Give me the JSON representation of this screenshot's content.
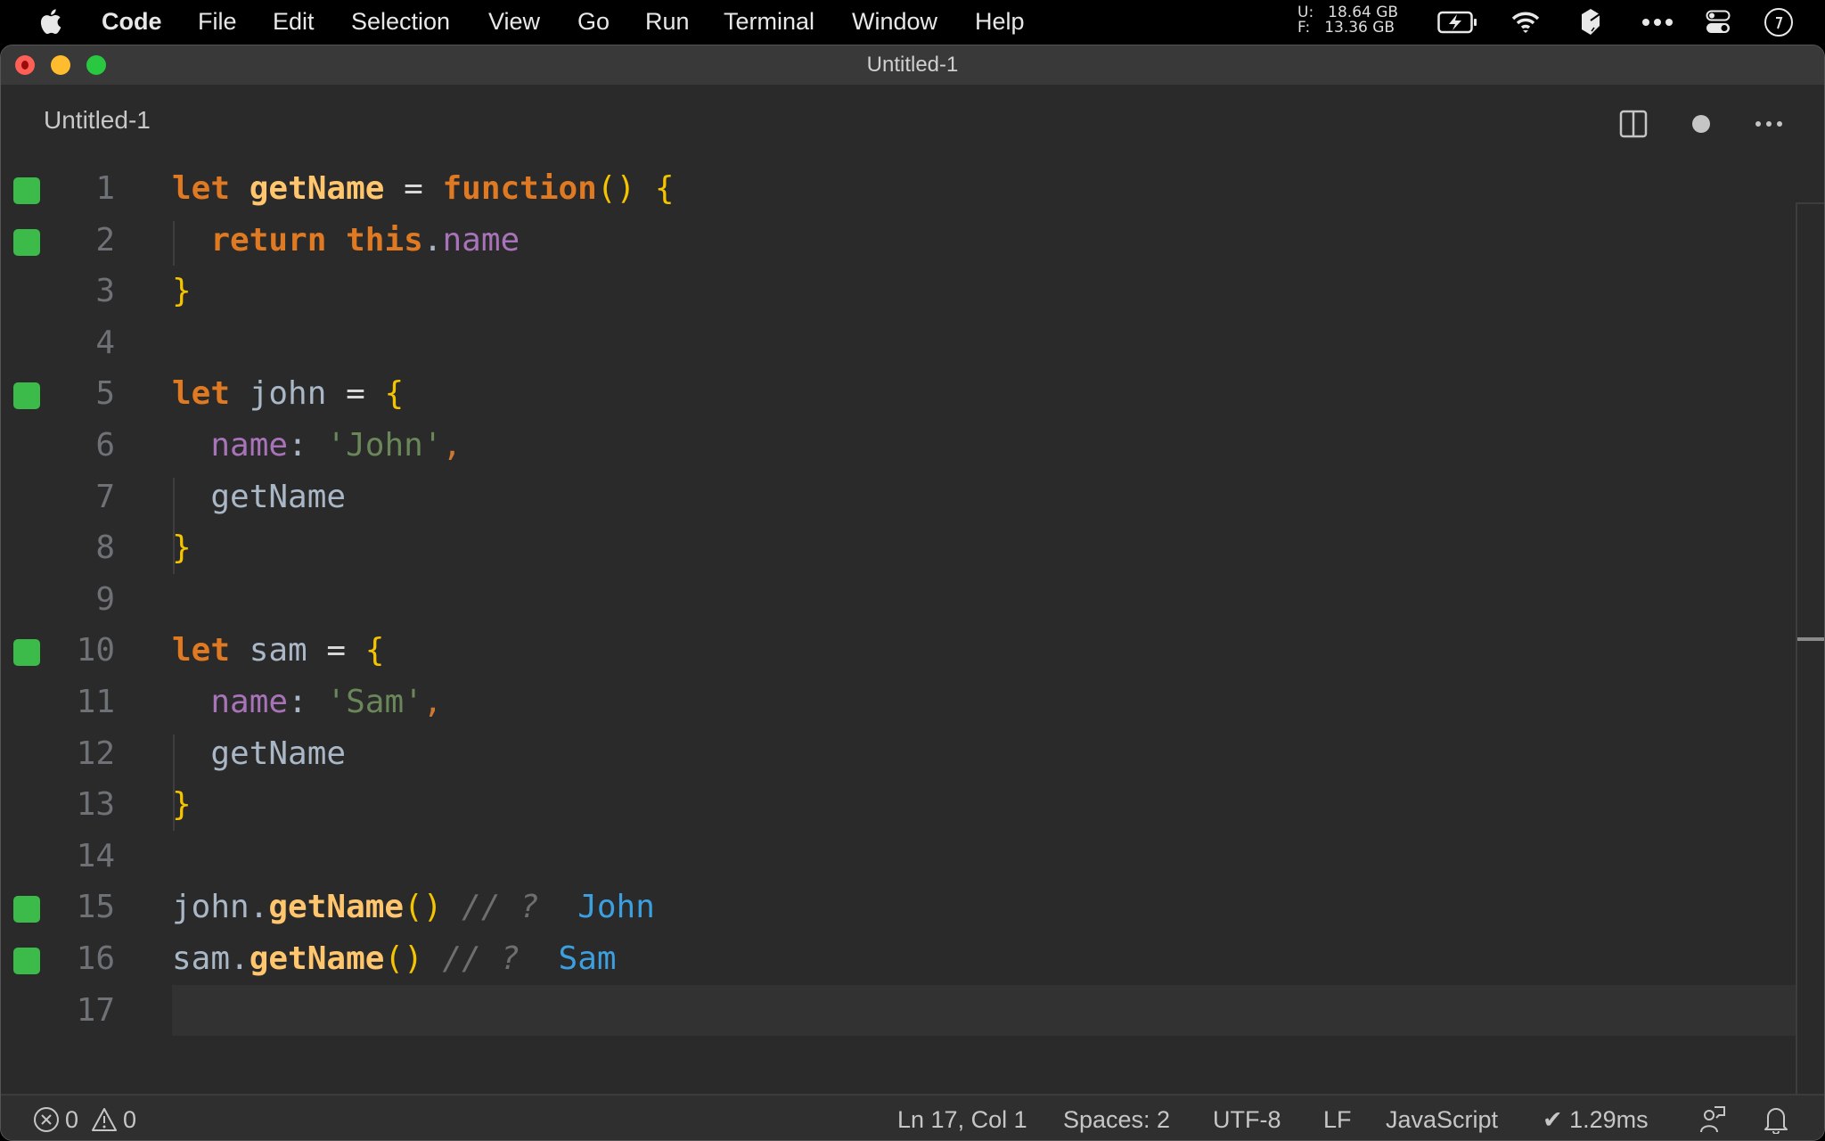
{
  "menubar": {
    "app_name": "Code",
    "items": [
      "File",
      "Edit",
      "Selection",
      "View",
      "Go",
      "Run",
      "Terminal",
      "Window",
      "Help"
    ],
    "memory": {
      "used_label": "U:",
      "used_value": "18.64 GB",
      "free_label": "F:",
      "free_value": "13.36 GB"
    },
    "tray_icons": [
      "battery-charging-icon",
      "wifi-icon",
      "box-icon",
      "more-icon",
      "control-center-icon",
      "clock-icon"
    ]
  },
  "window": {
    "title": "Untitled-1"
  },
  "tab": {
    "label": "Untitled-1",
    "actions": [
      "split-editor",
      "unsaved-indicator",
      "more-actions"
    ]
  },
  "editor": {
    "current_line": 17,
    "lines": [
      {
        "n": "1",
        "marker": true,
        "tokens": [
          [
            "kw",
            "let"
          ],
          [
            "var",
            " "
          ],
          [
            "fn",
            "getName"
          ],
          [
            "op",
            " = "
          ],
          [
            "kw",
            "function"
          ],
          [
            "paren",
            "()"
          ],
          [
            "op",
            " "
          ],
          [
            "brace",
            "{"
          ]
        ]
      },
      {
        "n": "2",
        "marker": true,
        "tokens": [
          [
            "var",
            "  "
          ],
          [
            "kw",
            "return"
          ],
          [
            "var",
            " "
          ],
          [
            "kw",
            "this"
          ],
          [
            "var",
            "."
          ],
          [
            "prop",
            "name"
          ]
        ]
      },
      {
        "n": "3",
        "marker": false,
        "tokens": [
          [
            "brace",
            "}"
          ]
        ]
      },
      {
        "n": "4",
        "marker": false,
        "tokens": []
      },
      {
        "n": "5",
        "marker": true,
        "tokens": [
          [
            "kw",
            "let"
          ],
          [
            "var",
            " john"
          ],
          [
            "op",
            " = "
          ],
          [
            "brace",
            "{"
          ]
        ]
      },
      {
        "n": "6",
        "marker": false,
        "tokens": [
          [
            "var",
            "  "
          ],
          [
            "prop",
            "name"
          ],
          [
            "var",
            ": "
          ],
          [
            "str",
            "'John'"
          ],
          [
            "punct",
            ","
          ]
        ]
      },
      {
        "n": "7",
        "marker": false,
        "tokens": [
          [
            "var",
            "  getName"
          ]
        ]
      },
      {
        "n": "8",
        "marker": false,
        "tokens": [
          [
            "brace",
            "}"
          ]
        ]
      },
      {
        "n": "9",
        "marker": false,
        "tokens": []
      },
      {
        "n": "10",
        "marker": true,
        "tokens": [
          [
            "kw",
            "let"
          ],
          [
            "var",
            " sam"
          ],
          [
            "op",
            " = "
          ],
          [
            "brace",
            "{"
          ]
        ]
      },
      {
        "n": "11",
        "marker": false,
        "tokens": [
          [
            "var",
            "  "
          ],
          [
            "prop",
            "name"
          ],
          [
            "var",
            ": "
          ],
          [
            "str",
            "'Sam'"
          ],
          [
            "punct",
            ","
          ]
        ]
      },
      {
        "n": "12",
        "marker": false,
        "tokens": [
          [
            "var",
            "  getName"
          ]
        ]
      },
      {
        "n": "13",
        "marker": false,
        "tokens": [
          [
            "brace",
            "}"
          ]
        ]
      },
      {
        "n": "14",
        "marker": false,
        "tokens": []
      },
      {
        "n": "15",
        "marker": true,
        "tokens": [
          [
            "var",
            "john."
          ],
          [
            "fn",
            "getName"
          ],
          [
            "paren",
            "()"
          ],
          [
            "var",
            " "
          ],
          [
            "comment",
            "// ?"
          ],
          [
            "var",
            "  "
          ],
          [
            "result",
            "John"
          ]
        ]
      },
      {
        "n": "16",
        "marker": true,
        "tokens": [
          [
            "var",
            "sam."
          ],
          [
            "fn",
            "getName"
          ],
          [
            "paren",
            "()"
          ],
          [
            "var",
            " "
          ],
          [
            "comment",
            "// ?"
          ],
          [
            "var",
            "  "
          ],
          [
            "result",
            "Sam"
          ]
        ]
      },
      {
        "n": "17",
        "marker": false,
        "tokens": []
      }
    ]
  },
  "statusbar": {
    "errors": "0",
    "warnings": "0",
    "position": "Ln 17, Col 1",
    "indent": "Spaces: 2",
    "encoding": "UTF-8",
    "eol": "LF",
    "language": "JavaScript",
    "timing": "✔ 1.29ms"
  },
  "colors": {
    "gutter_marker": "#3cba4a",
    "keyword": "#e07a22",
    "function": "#ffc66d",
    "string": "#6a8759",
    "property": "#a873b8",
    "result": "#3b9fe0"
  }
}
